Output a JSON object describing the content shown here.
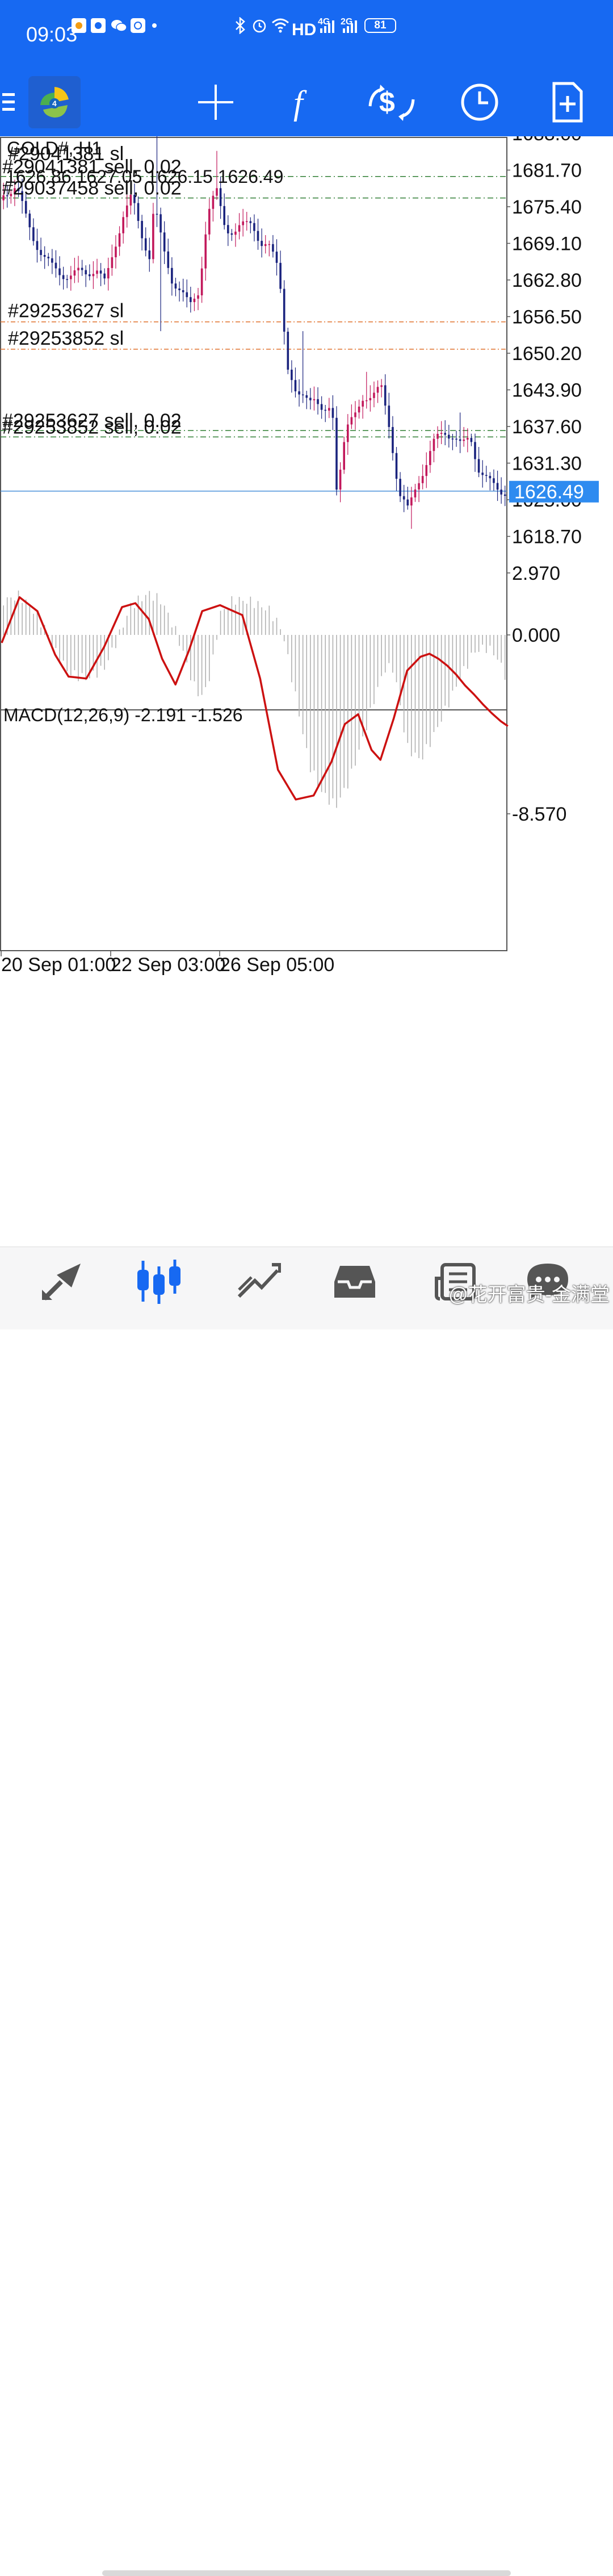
{
  "status_bar": {
    "time": "09:03",
    "network": "HD",
    "net_4g": "4G",
    "net_2g": "2G",
    "battery": "81",
    "icons": [
      "app-notification-icon",
      "app-notification-icon",
      "wechat-icon",
      "app-notification-icon",
      "dot-icon",
      "bluetooth-icon",
      "alarm-icon",
      "wifi-icon",
      "signal-icon",
      "signal-icon",
      "battery-icon"
    ]
  },
  "toolbar": {
    "items": [
      "menu-icon",
      "metatrader-logo",
      "crosshair-icon",
      "indicator-f-icon",
      "trade-icon",
      "period-clock-icon",
      "new-order-icon"
    ]
  },
  "chart": {
    "symbol_period": "GOLD#, H1",
    "ohlc": "1626.86 1627.05 1626.15 1626.49",
    "current_price": "1626.49",
    "price_axis": [
      "1688.00",
      "1681.70",
      "1675.40",
      "1669.10",
      "1662.80",
      "1656.50",
      "1650.20",
      "1643.90",
      "1637.60",
      "1631.30",
      "1625.00",
      "1618.70"
    ],
    "time_axis": [
      "20 Sep 01:00",
      "22 Sep 03:00",
      "26 Sep 05:00"
    ],
    "order_labels": [
      {
        "text": "#29041381 sl",
        "price": 1690.3,
        "color": "#e0722c"
      },
      {
        "text": "#29041381 sell, 0.02",
        "price": 1680.6,
        "color": "#2e7d32"
      },
      {
        "text": "#29037458 sell, 0.02",
        "price": 1676.9,
        "color": "#2e7d32"
      },
      {
        "text": "#29253627 sl",
        "price": 1655.6,
        "color": "#e0722c"
      },
      {
        "text": "#29253852 sl",
        "price": 1650.9,
        "color": "#e0722c"
      },
      {
        "text": "#29253627 sell, 0.02",
        "price": 1636.9,
        "color": "#2e7d32"
      },
      {
        "text": "#29253852 sell, 0.02",
        "price": 1635.8,
        "color": "#2e7d32"
      }
    ],
    "macd_label": "MACD(12,26,9) -2.191 -1.526",
    "macd_axis": [
      "2.970",
      "0.000",
      "-8.570"
    ],
    "colors": {
      "bull": "#c2185b",
      "bear": "#1a237e",
      "signal": "#cc1111",
      "histogram": "#b0b0b0",
      "bid_line": "#4a90d9",
      "sl_line": "#e0722c",
      "entry_line": "#2e7d32"
    }
  },
  "bottom_bar": {
    "items": [
      "quotes-icon",
      "chart-candles-icon",
      "trade-chart-icon",
      "history-inbox-icon",
      "news-icon",
      "chat-icon"
    ]
  },
  "watermark": "@花开富贵-金满堂"
}
